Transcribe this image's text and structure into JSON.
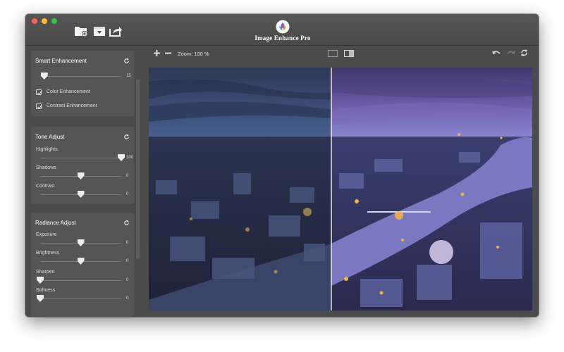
{
  "window": {
    "app_title": "Image Enhance Pro"
  },
  "toolbar": {
    "zoom_label": "Zoom: 100 %"
  },
  "sidebar": {
    "smart": {
      "title": "Smart Enhancement",
      "slider_value": "15",
      "slider_fraction": 0.05,
      "options": [
        {
          "label": "Color Enhancement",
          "checked": true
        },
        {
          "label": "Contrast Enhancement",
          "checked": true
        }
      ]
    },
    "tone": {
      "title": "Tone Adjust",
      "sliders": [
        {
          "label": "Highlights",
          "value": "100",
          "fraction": 1.0
        },
        {
          "label": "Shadows",
          "value": "0",
          "fraction": 0.5
        },
        {
          "label": "Contrast",
          "value": "0",
          "fraction": 0.5
        }
      ]
    },
    "radiance": {
      "title": "Radiance Adjust",
      "sliders": [
        {
          "label": "Exposure",
          "value": "0",
          "fraction": 0.5
        },
        {
          "label": "Brightness",
          "value": "0",
          "fraction": 0.5
        },
        {
          "label": "Sharpen",
          "value": "0",
          "fraction": 0.0
        },
        {
          "label": "Softness",
          "value": "0",
          "fraction": 0.0
        }
      ]
    }
  },
  "viewer": {
    "split_fraction": 0.475
  },
  "colors": {
    "window_bg": "#4b4b4b",
    "panel_bg": "#555555",
    "sky_before": "#3c4d78",
    "sky_after": "#6a5aa6",
    "river": "#7a78c0",
    "lights": "#f2b04a"
  }
}
